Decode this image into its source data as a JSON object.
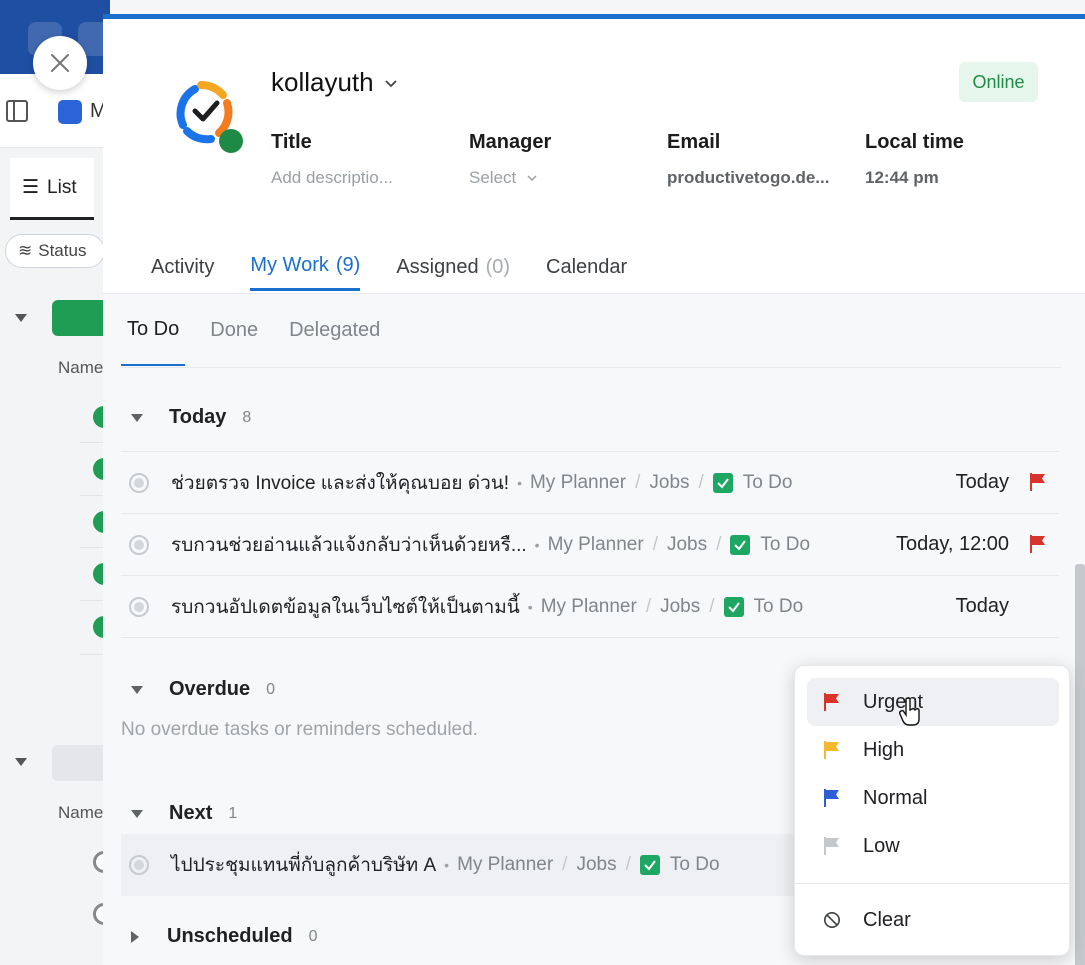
{
  "background": {
    "list_tab_label": "List",
    "status_chip_label": "Status",
    "column_name_label": "Name",
    "app_letter": "M"
  },
  "profile": {
    "username": "kollayuth",
    "status": "Online",
    "fields": [
      {
        "label": "Title",
        "value": "Add descriptio..."
      },
      {
        "label": "Manager",
        "value": "Select"
      },
      {
        "label": "Email",
        "value": "productivetogo.de..."
      },
      {
        "label": "Local time",
        "value": "12:44 pm"
      }
    ]
  },
  "tabs": [
    {
      "label": "Activity",
      "count": ""
    },
    {
      "label": "My Work",
      "count": "(9)"
    },
    {
      "label": "Assigned",
      "count": "(0)"
    },
    {
      "label": "Calendar",
      "count": ""
    }
  ],
  "subtabs": [
    "To Do",
    "Done",
    "Delegated"
  ],
  "sections": {
    "today": {
      "label": "Today",
      "count": "8"
    },
    "overdue": {
      "label": "Overdue",
      "count": "0",
      "empty_message": "No overdue tasks or reminders scheduled."
    },
    "next": {
      "label": "Next",
      "count": "1"
    },
    "unscheduled": {
      "label": "Unscheduled",
      "count": "0"
    }
  },
  "today_tasks": [
    {
      "title": "ช่วยตรวจ Invoice และส่งให้คุณบอย ด่วน!",
      "planner": "My Planner",
      "list": "Jobs",
      "status": "To Do",
      "date": "Today",
      "flag": "urgent"
    },
    {
      "title": "รบกวนช่วยอ่านแล้วแจ้งกลับว่าเห็นด้วยหรื...",
      "planner": "My Planner",
      "list": "Jobs",
      "status": "To Do",
      "date": "Today, 12:00",
      "flag": "urgent"
    },
    {
      "title": "รบกวนอัปเดตข้อมูลในเว็บไซต์ให้เป็นตามนี้",
      "planner": "My Planner",
      "list": "Jobs",
      "status": "To Do",
      "date": "Today",
      "flag": ""
    }
  ],
  "next_tasks": [
    {
      "title": "ไปประชุมแทนพี่กับลูกค้าบริษัท A",
      "planner": "My Planner",
      "list": "Jobs",
      "status": "To Do"
    }
  ],
  "priority_menu": {
    "items": [
      {
        "label": "Urgent",
        "color": "#d9342b"
      },
      {
        "label": "High",
        "color": "#f5b82e"
      },
      {
        "label": "Normal",
        "color": "#2f5fd6"
      },
      {
        "label": "Low",
        "color": "#c4c7cc"
      }
    ],
    "clear_label": "Clear"
  },
  "colors": {
    "accent": "#1a6fce",
    "online_bg": "#e7f6ec",
    "online_text": "#1e8a45",
    "status_check": "#1ea763"
  }
}
